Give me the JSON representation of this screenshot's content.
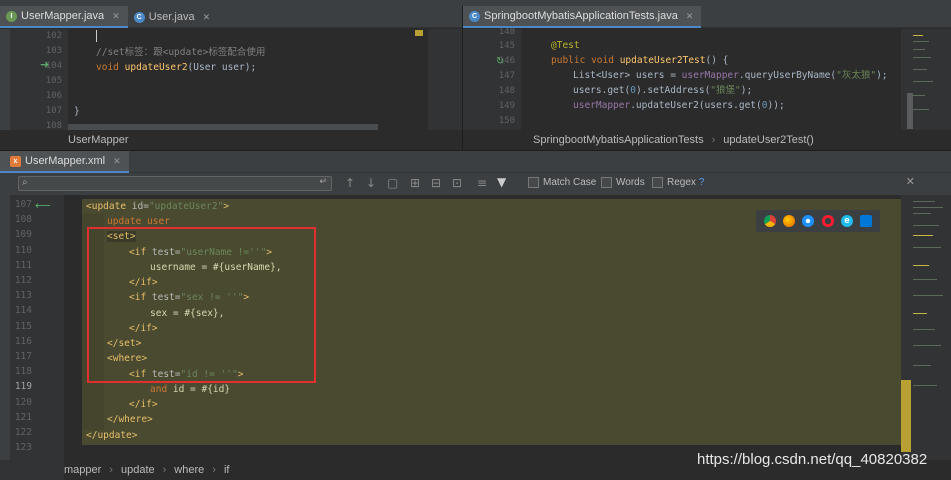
{
  "top_left": {
    "tabs": [
      {
        "label": "UserMapper.java",
        "icon": "interface-icon",
        "color": "#6a9955",
        "active": true
      },
      {
        "label": "User.java",
        "icon": "class-icon",
        "color": "#4a88c7",
        "active": false
      }
    ],
    "lines": [
      "102",
      "103",
      "104",
      "105",
      "106",
      "107",
      "108"
    ],
    "code": {
      "comment": "//set标签：跟<update>标签配合使用",
      "kw_void": "void",
      "method": "updateUser2",
      "params": "(User user);",
      "brace": "}"
    },
    "breadcrumb": "UserMapper"
  },
  "top_right": {
    "tabs": [
      {
        "label": "SpringbootMybatisApplicationTests.java",
        "icon": "class-icon",
        "color": "#4a88c7",
        "active": true
      }
    ],
    "lines": [
      "148",
      "145",
      "146",
      "147",
      "148",
      "149",
      "150"
    ],
    "code": {
      "annotation": "@Test",
      "kw_public": "public",
      "kw_void": "void",
      "method": "updateUser2Test",
      "sig_end": "() {",
      "l147_a": "List<User> users = ",
      "l147_b": "userMapper",
      "l147_c": ".queryUserByName(",
      "l147_str": "\"灰太狼\"",
      "l147_d": ");",
      "l148_a": "users.get(",
      "l148_num": "0",
      "l148_b": ").setAddress(",
      "l148_str": "\"狼堡\"",
      "l148_c": ");",
      "l149_a": "userMapper",
      "l149_b": ".updateUser2(users.get(",
      "l149_num": "0",
      "l149_c": "));"
    },
    "breadcrumb": [
      "SpringbootMybatisApplicationTests",
      "updateUser2Test()"
    ]
  },
  "bottom": {
    "tab": {
      "label": "UserMapper.xml",
      "icon": "xml-icon",
      "color": "#e07b39"
    },
    "search": {
      "value": "",
      "placeholder": ""
    },
    "options": [
      "Match Case",
      "Words",
      "Regex"
    ],
    "help": "?",
    "lines": [
      "107",
      "108",
      "109",
      "110",
      "111",
      "112",
      "113",
      "114",
      "115",
      "116",
      "117",
      "118",
      "119",
      "120",
      "121",
      "122",
      "123"
    ],
    "code": {
      "l107_open": "<update ",
      "l107_attr": "id=",
      "l107_val": "\"updateUser2\"",
      "l107_close": ">",
      "l108": "update user",
      "l109": "<set>",
      "l110_open": "<if ",
      "l110_attr": "test=",
      "l110_val": "\"userName !=''\"",
      "l110_close": ">",
      "l111": "username = #{userName},",
      "l112": "</if>",
      "l113_open": "<if ",
      "l113_attr": "test=",
      "l113_val": "\"sex != ''\"",
      "l113_close": ">",
      "l114": "sex = #{sex},",
      "l115": "</if>",
      "l116": "</set>",
      "l117": "<where>",
      "l118_open": "<if ",
      "l118_attr": "test=",
      "l118_val": "\"id != ''\"",
      "l118_close": ">",
      "l119_kw": "and",
      "l119_rest": " id = #{id}",
      "l120": "</if>",
      "l121": "</where>",
      "l122": "</update>"
    },
    "breadcrumb": [
      "mapper",
      "update",
      "where",
      "if"
    ],
    "watermark": "https://blog.csdn.net/qq_40820382",
    "browsers": [
      "chrome-icon",
      "firefox-icon",
      "safari-icon",
      "opera-icon",
      "ie-icon",
      "edge-icon"
    ],
    "colors": {
      "highlight": "#4a4a30",
      "setbox": "#e03030"
    }
  }
}
